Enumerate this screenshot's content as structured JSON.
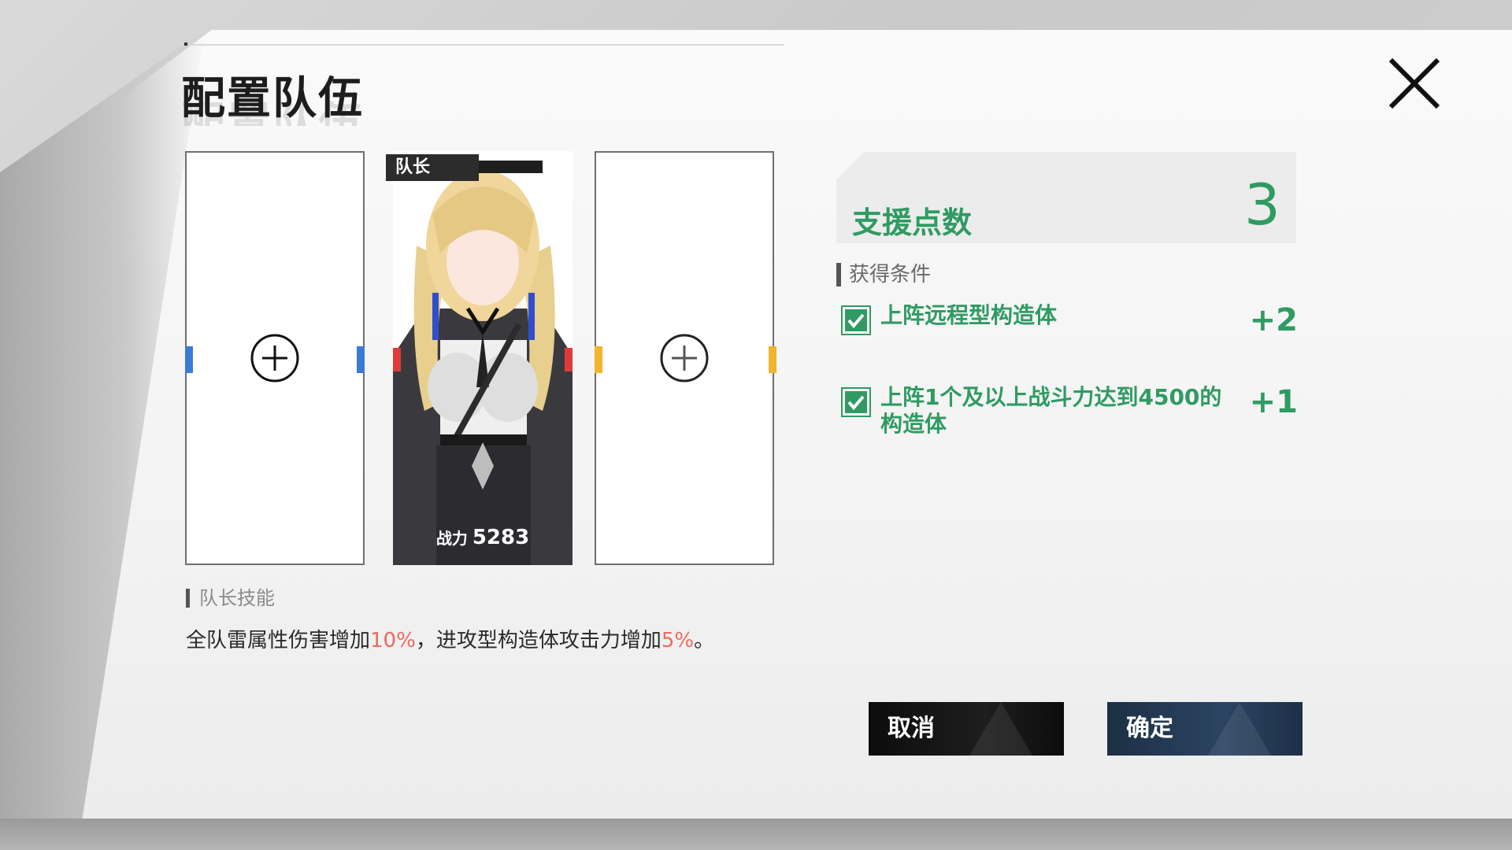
{
  "header": {
    "title": "配置队伍"
  },
  "team": {
    "leader_tag": "队长",
    "power_label": "战力",
    "power_value": "5283"
  },
  "skill": {
    "heading": "队长技能",
    "desc_part1": "全队雷属性伤害增加",
    "desc_value1": "10%",
    "desc_part2": "，进攻型构造体攻击力增加",
    "desc_value2": "5%",
    "desc_part3": "。"
  },
  "support": {
    "label": "支援点数",
    "value": "3",
    "conditions_heading": "获得条件",
    "conditions": [
      {
        "text": "上阵远程型构造体",
        "bonus": "+2",
        "checked": true
      },
      {
        "text": "上阵1个及以上战斗力达到4500的构造体",
        "bonus": "+1",
        "checked": true
      }
    ]
  },
  "buttons": {
    "cancel": "取消",
    "confirm": "确定"
  },
  "icons": {
    "close": "close-icon",
    "add": "plus-circle-icon",
    "check": "check-icon"
  },
  "colors": {
    "accent_green": "#2f9b62",
    "highlight_red": "#ee6a5e",
    "confirm_blue": "#2c4462"
  }
}
